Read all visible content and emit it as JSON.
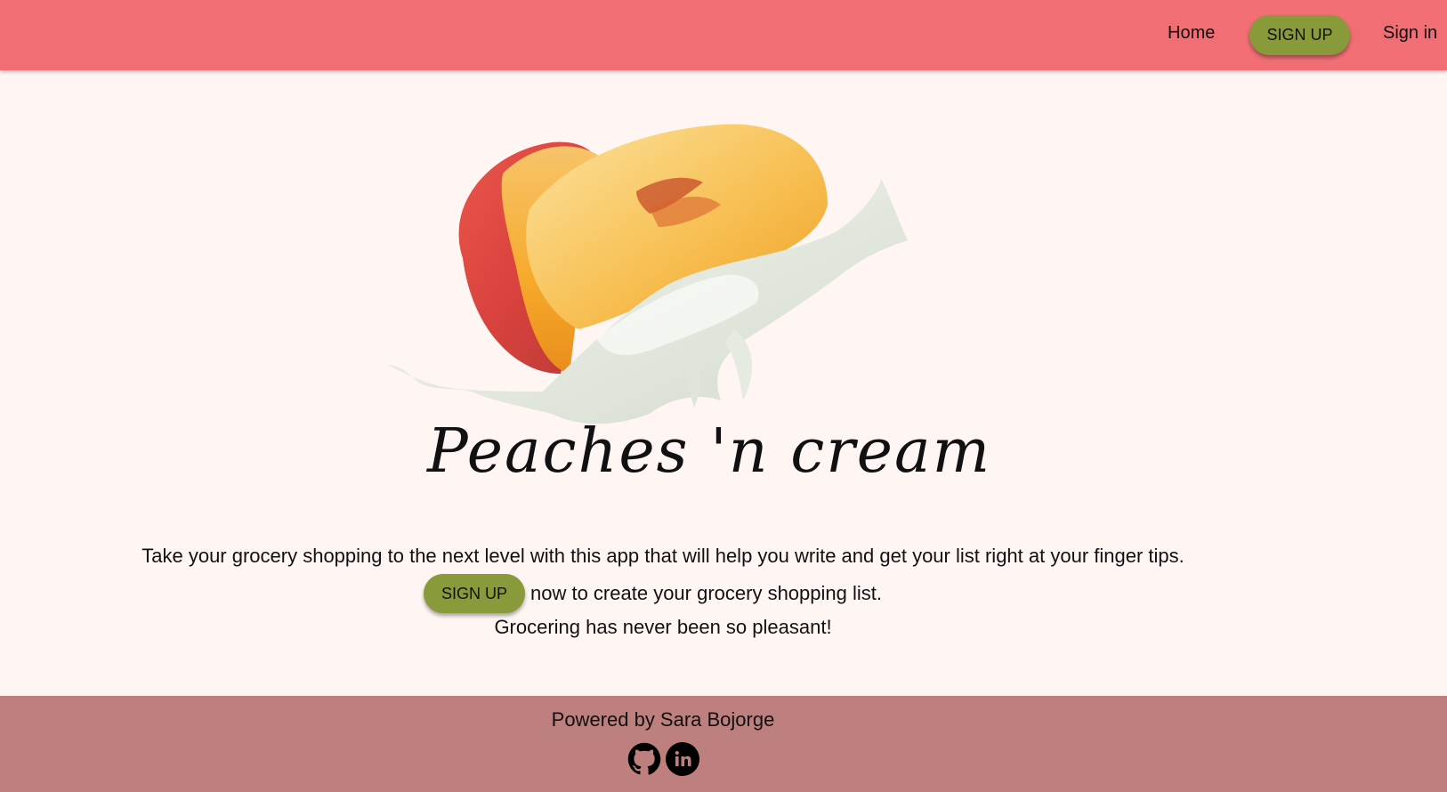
{
  "nav": {
    "home_label": "Home",
    "signup_label": "SIGN UP",
    "signin_label": "Sign in",
    "bar_color": "#f06e74",
    "accent_color": "#889a3a"
  },
  "hero": {
    "logo_text": "Peaches 'n cream",
    "image": "peach-slices-with-cream-splash"
  },
  "main": {
    "intro_text": "Take your grocery shopping to the next level with this app that will help you write and get your list right at your finger tips.",
    "cta_button_label": "SIGN UP",
    "cta_text": "now to create your grocery shopping list.",
    "tagline": "Grocering has never been so pleasant!"
  },
  "footer": {
    "powered_by": "Powered by Sara Bojorge",
    "icons": [
      "github-icon",
      "linkedin-icon"
    ],
    "bg_color": "#bd807e"
  }
}
